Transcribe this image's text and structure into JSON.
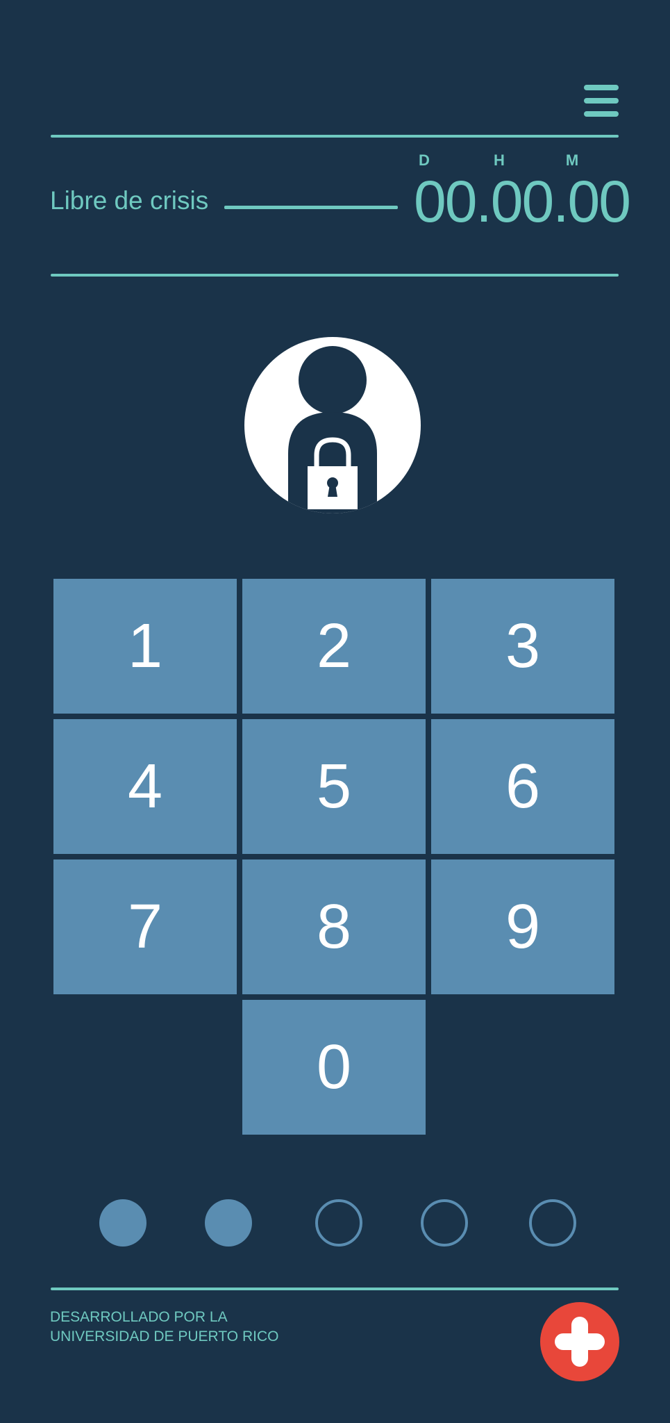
{
  "header": {
    "menu_icon": "menu-icon"
  },
  "status": {
    "label": "Libre de crisis",
    "units": {
      "days": "D",
      "hours": "H",
      "minutes": "M"
    },
    "time": "00.00.00"
  },
  "avatar": {
    "icon": "locked-user-icon"
  },
  "keypad": {
    "keys": [
      "1",
      "2",
      "3",
      "4",
      "5",
      "6",
      "7",
      "8",
      "9",
      "0"
    ]
  },
  "pin": {
    "length": 5,
    "entered": 2
  },
  "footer": {
    "line1": "DESARROLLADO POR LA",
    "line2": "UNIVERSIDAD DE PUERTO RICO",
    "emergency_icon": "plus-icon"
  },
  "colors": {
    "background": "#1a3349",
    "accent": "#6fc9c0",
    "key": "#5a8db1",
    "emergency": "#e8473a"
  }
}
